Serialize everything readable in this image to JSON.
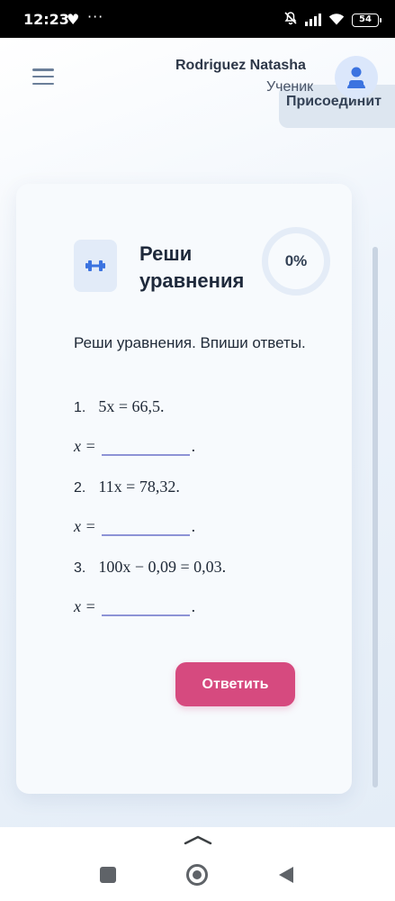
{
  "status_bar": {
    "time": "12:23",
    "heart_icon": "heart-icon",
    "dots": "···",
    "battery": "54"
  },
  "header": {
    "user_name": "Rodriguez Natasha",
    "user_role": "Ученик",
    "join_label": "Присоединит",
    "menu_icon": "hamburger-menu-icon",
    "avatar_icon": "person-icon"
  },
  "task": {
    "icon": "dumbbell-icon",
    "title": "Реши уравнения",
    "progress": "0%",
    "instruction": "Реши уравнения. Впиши ответы.",
    "equations": [
      {
        "number": "1.",
        "expr": "5x = 66,5."
      },
      {
        "number": "2.",
        "expr": "11x = 78,32."
      },
      {
        "number": "3.",
        "expr": "100x − 0,09 = 0,03."
      }
    ],
    "answer_prefix": "x =",
    "answer_suffix": ".",
    "submit_label": "Ответить"
  },
  "colors": {
    "accent": "#d64a7f",
    "icon_blue": "#3b73e0",
    "input_underline": "#8d93d6"
  }
}
